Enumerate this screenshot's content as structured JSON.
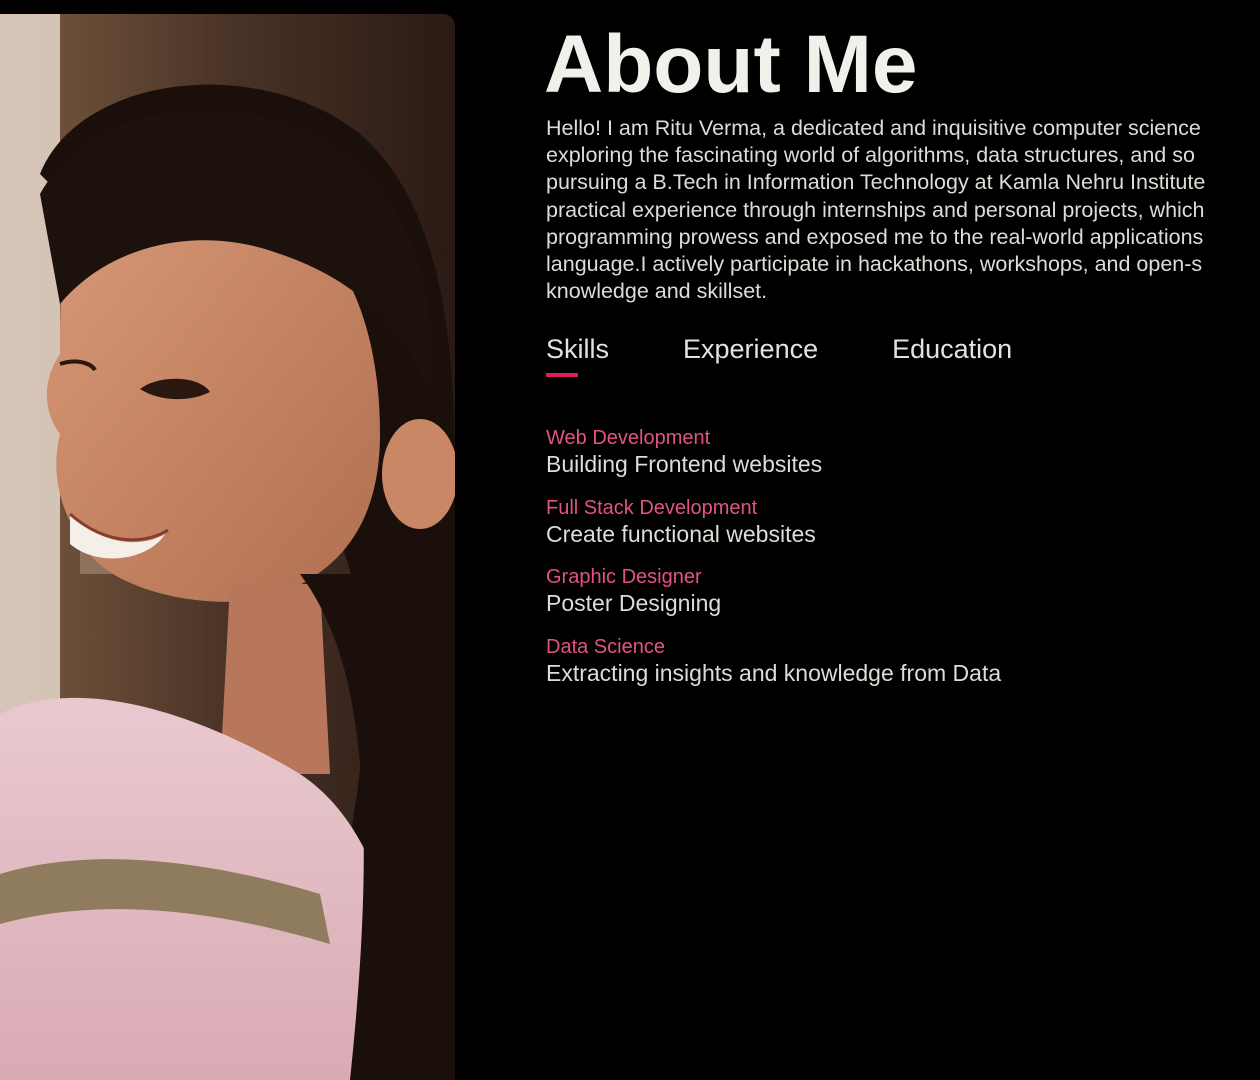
{
  "about": {
    "title": "About Me",
    "intro_lines": [
      "Hello! I am Ritu Verma, a dedicated and inquisitive computer science",
      "exploring the fascinating world of algorithms, data structures, and so",
      "pursuing a B.Tech in Information Technology at Kamla Nehru Institute",
      "practical experience through internships and personal projects, which",
      "programming prowess and exposed me to the real-world applications",
      "language.I actively participate in hackathons, workshops, and open-s",
      "knowledge and skillset."
    ]
  },
  "tabs": [
    {
      "label": "Skills",
      "active": true
    },
    {
      "label": "Experience",
      "active": false
    },
    {
      "label": "Education",
      "active": false
    }
  ],
  "skills": [
    {
      "name": "Web Development",
      "description": "Building Frontend websites"
    },
    {
      "name": "Full Stack Development",
      "description": "Create functional websites"
    },
    {
      "name": "Graphic Designer",
      "description": "Poster Designing"
    },
    {
      "name": "Data Science",
      "description": "Extracting insights and knowledge from Data"
    }
  ],
  "colors": {
    "background": "#000000",
    "accent": "#e01e58",
    "skill_name": "#e2547f",
    "text": "#dedcd6"
  },
  "photo": {
    "icon": "profile-photo"
  }
}
